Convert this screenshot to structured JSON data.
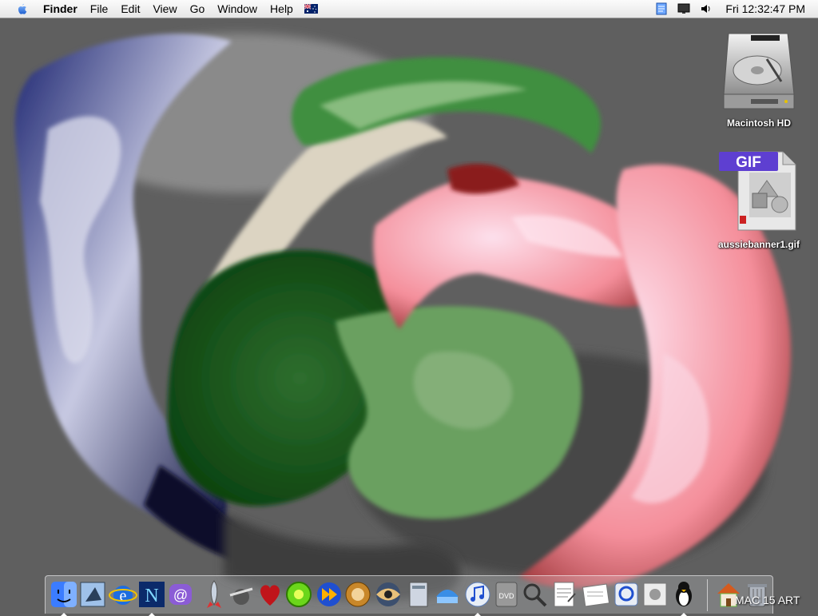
{
  "menubar": {
    "app_name": "Finder",
    "menus": [
      "File",
      "Edit",
      "View",
      "Go",
      "Window",
      "Help"
    ],
    "input_flag": "australia-flag-icon",
    "clock": "Fri 12:32:47 PM"
  },
  "desktop": {
    "icons": [
      {
        "label": "Macintosh HD",
        "icon": "hard-drive-icon"
      },
      {
        "label": "aussiebanner1.gif",
        "icon": "gif-file-icon",
        "badge": "GIF"
      }
    ]
  },
  "dock": {
    "caption": "MAC 15 ART",
    "apps": [
      "finder",
      "mail",
      "internet-explorer",
      "netscape",
      "sherlock",
      "rocket",
      "iseek",
      "heart",
      "bluecircle",
      "forward",
      "gear-clock",
      "eye",
      "disk-utility",
      "network",
      "itunes",
      "dvd-player",
      "search",
      "text-edit",
      "notes",
      "quicktime",
      "apple-system",
      "penguin",
      "home",
      "trash"
    ]
  },
  "colors": {
    "wallpaper_gray": "#5e5e5e",
    "swirl_blue": "#1e2a66",
    "swirl_green": "#2f7a2f",
    "swirl_pink": "#f2a6b8"
  }
}
